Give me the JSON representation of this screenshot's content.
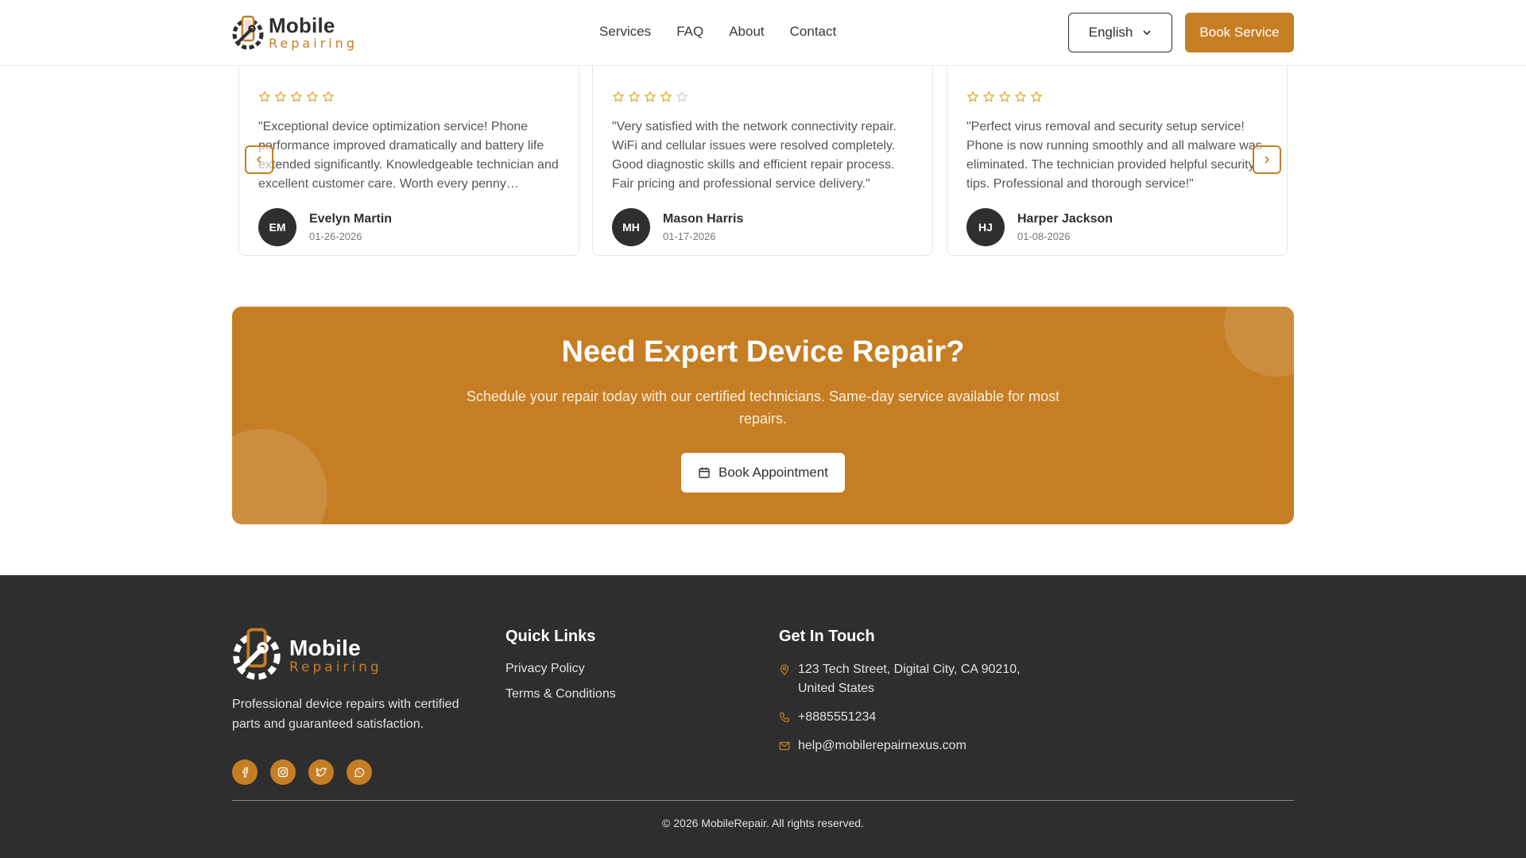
{
  "header": {
    "logo_title": "Mobile",
    "logo_sub": "Repairing",
    "nav": [
      "Services",
      "FAQ",
      "About",
      "Contact"
    ],
    "language": "English",
    "book_label": "Book Service"
  },
  "reviews": [
    {
      "rating": 5,
      "text": "\"Exceptional device optimization service! Phone performance improved dramatically and battery life extended significantly. Knowledgeable technician and excellent customer care. Worth every penny…",
      "initials": "EM",
      "name": "Evelyn Martin",
      "date": "01-26-2026"
    },
    {
      "rating": 4,
      "text": "\"Very satisfied with the network connectivity repair. WiFi and cellular issues were resolved completely. Good diagnostic skills and efficient repair process. Fair pricing and professional service delivery.\"",
      "initials": "MH",
      "name": "Mason Harris",
      "date": "01-17-2026"
    },
    {
      "rating": 5,
      "text": "\"Perfect virus removal and security setup service! Phone is now running smoothly and all malware was eliminated. The technician provided helpful security tips. Professional and thorough service!\"",
      "initials": "HJ",
      "name": "Harper Jackson",
      "date": "01-08-2026"
    }
  ],
  "cta": {
    "title": "Need Expert Device Repair?",
    "subtitle": "Schedule your repair today with our certified technicians. Same-day service available for most repairs.",
    "button": "Book Appointment"
  },
  "footer": {
    "logo_title": "Mobile",
    "logo_sub": "Repairing",
    "description": "Professional device repairs with certified parts and guaranteed satisfaction.",
    "quick_links_title": "Quick Links",
    "quick_links": [
      "Privacy Policy",
      "Terms & Conditions"
    ],
    "contact_title": "Get In Touch",
    "address": "123 Tech Street, Digital City, CA 90210, United States",
    "phone": "+8885551234",
    "email": "help@mobilerepairnexus.com",
    "socials": [
      "facebook-icon",
      "instagram-icon",
      "twitter-icon",
      "whatsapp-icon"
    ],
    "copyright": "© 2026 MobileRepair. All rights reserved."
  },
  "colors": {
    "accent": "#c67e24",
    "dark": "#2e2e2e",
    "star": "#e0a820",
    "star_empty": "#cfcfcf"
  }
}
